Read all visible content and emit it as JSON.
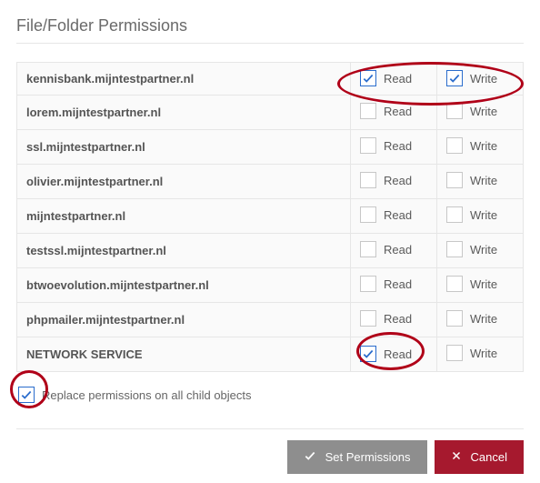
{
  "title": "File/Folder Permissions",
  "labels": {
    "read": "Read",
    "write": "Write"
  },
  "rows": [
    {
      "name": "kennisbank.mijntestpartner.nl",
      "read": true,
      "write": true
    },
    {
      "name": "lorem.mijntestpartner.nl",
      "read": false,
      "write": false
    },
    {
      "name": "ssl.mijntestpartner.nl",
      "read": false,
      "write": false
    },
    {
      "name": "olivier.mijntestpartner.nl",
      "read": false,
      "write": false
    },
    {
      "name": "mijntestpartner.nl",
      "read": false,
      "write": false
    },
    {
      "name": "testssl.mijntestpartner.nl",
      "read": false,
      "write": false
    },
    {
      "name": "btwoevolution.mijntestpartner.nl",
      "read": false,
      "write": false
    },
    {
      "name": "phpmailer.mijntestpartner.nl",
      "read": false,
      "write": false
    },
    {
      "name": "NETWORK SERVICE",
      "read": true,
      "write": false
    }
  ],
  "child": {
    "label": "Replace permissions on all child objects",
    "checked": true
  },
  "buttons": {
    "set": "Set Permissions",
    "cancel": "Cancel"
  }
}
